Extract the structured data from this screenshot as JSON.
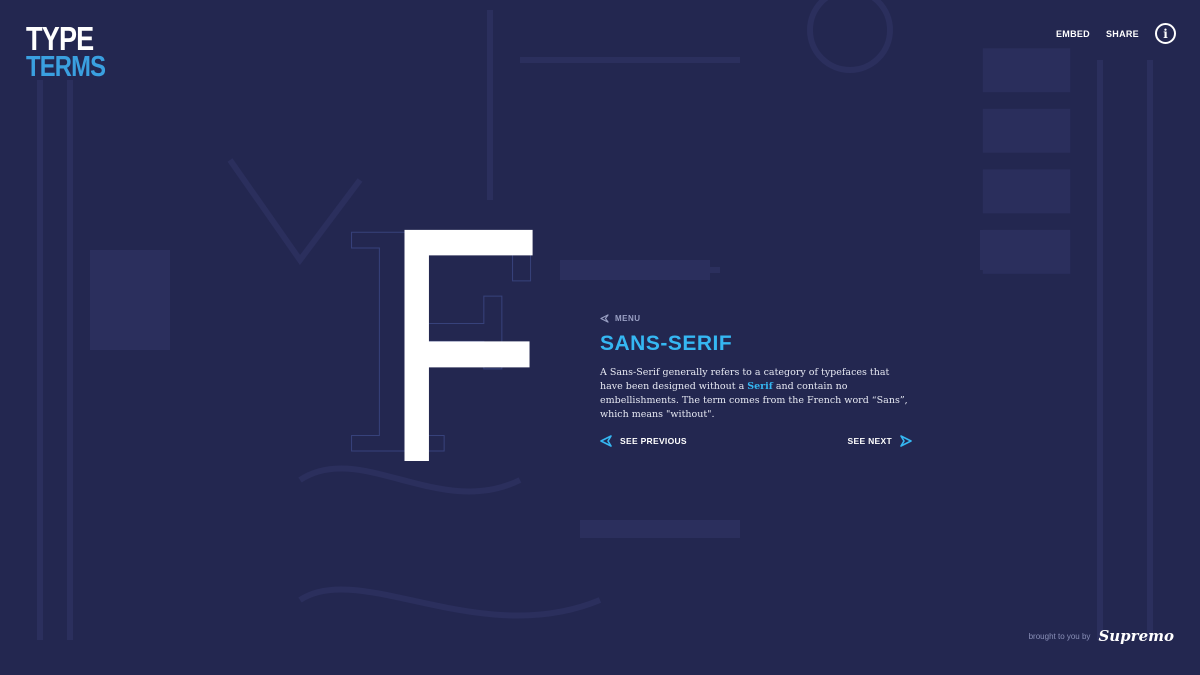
{
  "brand": {
    "logo_line1": "TYPE",
    "logo_line2": "TERMS"
  },
  "topnav": {
    "embed_label": "EMBED",
    "share_label": "SHARE",
    "info_glyph": "i"
  },
  "term": {
    "glyph": "F",
    "menu_label": "MENU",
    "title": "SANS-SERIF",
    "desc_part1": "A Sans-Serif generally refers to a category of typefaces that have been designed without a ",
    "desc_link": "Serif",
    "desc_part2": " and contain no embellishments. The term comes from the French word “Sans”, which means \"without\"."
  },
  "pager": {
    "previous_label": "SEE PREVIOUS",
    "next_label": "SEE NEXT"
  },
  "credit": {
    "prefix": "brought to you by",
    "brand": "Supremo"
  },
  "colors": {
    "background": "#232750",
    "accent": "#35b7f2",
    "text": "#ffffff"
  },
  "icons": {
    "menu": "back-arrow-outline-icon",
    "previous": "triangle-left-icon",
    "next": "triangle-right-icon",
    "info": "info-circle-icon"
  }
}
